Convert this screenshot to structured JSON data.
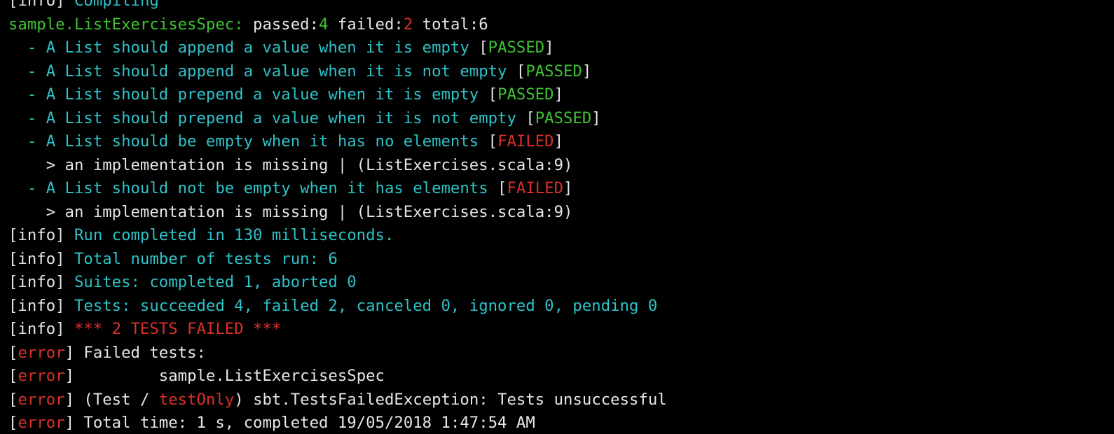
{
  "terminal": {
    "lines": [
      [
        {
          "text": "[",
          "color": "w"
        },
        {
          "text": "info",
          "color": "w"
        },
        {
          "text": "] ",
          "color": "w"
        },
        {
          "text": "Compiling",
          "color": "c"
        }
      ],
      [
        {
          "text": "sample.ListExercisesSpec: ",
          "color": "g"
        },
        {
          "text": "passed:",
          "color": "w"
        },
        {
          "text": "4",
          "color": "g"
        },
        {
          "text": " failed:",
          "color": "w"
        },
        {
          "text": "2",
          "color": "r"
        },
        {
          "text": " total:6",
          "color": "w"
        }
      ],
      [
        {
          "text": "  - A List should append a value when it is empty ",
          "color": "c"
        },
        {
          "text": "[",
          "color": "w"
        },
        {
          "text": "PASSED",
          "color": "g"
        },
        {
          "text": "]",
          "color": "w"
        }
      ],
      [
        {
          "text": "  - A List should append a value when it is not empty ",
          "color": "c"
        },
        {
          "text": "[",
          "color": "w"
        },
        {
          "text": "PASSED",
          "color": "g"
        },
        {
          "text": "]",
          "color": "w"
        }
      ],
      [
        {
          "text": "  - A List should prepend a value when it is empty ",
          "color": "c"
        },
        {
          "text": "[",
          "color": "w"
        },
        {
          "text": "PASSED",
          "color": "g"
        },
        {
          "text": "]",
          "color": "w"
        }
      ],
      [
        {
          "text": "  - A List should prepend a value when it is not empty ",
          "color": "c"
        },
        {
          "text": "[",
          "color": "w"
        },
        {
          "text": "PASSED",
          "color": "g"
        },
        {
          "text": "]",
          "color": "w"
        }
      ],
      [
        {
          "text": "  - A List should be empty when it has no elements ",
          "color": "c"
        },
        {
          "text": "[",
          "color": "w"
        },
        {
          "text": "FAILED",
          "color": "r"
        },
        {
          "text": "]",
          "color": "w"
        }
      ],
      [
        {
          "text": "    > an implementation is missing | (ListExercises.scala:9)",
          "color": "w"
        }
      ],
      [
        {
          "text": "  - A List should not be empty when it has elements ",
          "color": "c"
        },
        {
          "text": "[",
          "color": "w"
        },
        {
          "text": "FAILED",
          "color": "r"
        },
        {
          "text": "]",
          "color": "w"
        }
      ],
      [
        {
          "text": "    > an implementation is missing | (ListExercises.scala:9)",
          "color": "w"
        }
      ],
      [
        {
          "text": "[info] ",
          "color": "w"
        },
        {
          "text": "Run completed in 130 milliseconds.",
          "color": "c"
        }
      ],
      [
        {
          "text": "[info] ",
          "color": "w"
        },
        {
          "text": "Total number of tests run: 6",
          "color": "c"
        }
      ],
      [
        {
          "text": "[info] ",
          "color": "w"
        },
        {
          "text": "Suites: completed 1, aborted 0",
          "color": "c"
        }
      ],
      [
        {
          "text": "[info] ",
          "color": "w"
        },
        {
          "text": "Tests: succeeded 4, failed 2, canceled 0, ignored 0, pending 0",
          "color": "c"
        }
      ],
      [
        {
          "text": "[info] ",
          "color": "w"
        },
        {
          "text": "*** 2 TESTS FAILED ***",
          "color": "r"
        }
      ],
      [
        {
          "text": "[",
          "color": "w"
        },
        {
          "text": "error",
          "color": "r"
        },
        {
          "text": "] Failed tests:",
          "color": "w"
        }
      ],
      [
        {
          "text": "[",
          "color": "w"
        },
        {
          "text": "error",
          "color": "r"
        },
        {
          "text": "] \t\tsample.ListExercisesSpec",
          "color": "w"
        }
      ],
      [
        {
          "text": "[",
          "color": "w"
        },
        {
          "text": "error",
          "color": "r"
        },
        {
          "text": "] (Test / ",
          "color": "w"
        },
        {
          "text": "testOnly",
          "color": "r"
        },
        {
          "text": ") sbt.TestsFailedException: Tests unsuccessful",
          "color": "w"
        }
      ],
      [
        {
          "text": "[",
          "color": "w"
        },
        {
          "text": "error",
          "color": "r"
        },
        {
          "text": "] Total time: 1 s, completed 19/05/2018 1:47:54 AM",
          "color": "w"
        }
      ]
    ]
  }
}
